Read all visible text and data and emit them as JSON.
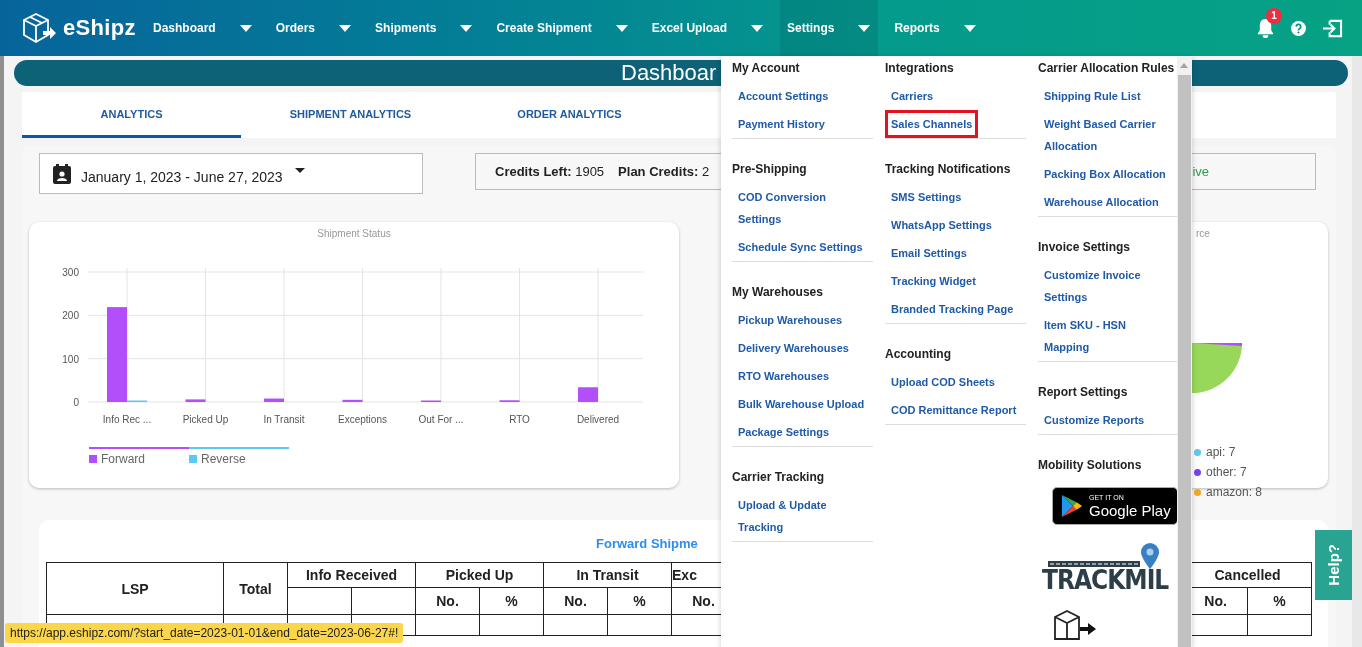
{
  "nav": {
    "brand": "eShipz",
    "items": [
      {
        "label": "Dashboard",
        "selected": false
      },
      {
        "label": "Orders",
        "selected": false
      },
      {
        "label": "Shipments",
        "selected": false
      },
      {
        "label": "Create Shipment",
        "selected": false
      },
      {
        "label": "Excel Upload",
        "selected": false
      },
      {
        "label": "Settings",
        "selected": true
      },
      {
        "label": "Reports",
        "selected": false
      }
    ],
    "notification_count": "1"
  },
  "page_title": "Dashboar",
  "tabs": [
    {
      "label": "ANALYTICS",
      "selected": true
    },
    {
      "label": "SHIPMENT ANALYTICS",
      "selected": false
    },
    {
      "label": "ORDER ANALYTICS",
      "selected": false
    }
  ],
  "filters": {
    "date_range": "January 1, 2023 - June 27, 2023",
    "credits": [
      {
        "label": "Credits Left:",
        "value": "1905"
      },
      {
        "label": "Plan Credits:",
        "value": "2"
      }
    ],
    "status_fragment": "ive"
  },
  "shipment_status_card": {
    "chart_data": {
      "type": "bar",
      "title": "Shipment Status",
      "categories": [
        "Info Rec ...",
        "Picked Up",
        "In Transit",
        "Exceptions",
        "Out For ...",
        "RTO",
        "Delivered"
      ],
      "series": [
        {
          "name": "Forward",
          "color": "#b24ffa",
          "values": [
            219,
            6,
            8,
            5,
            3,
            4,
            34
          ]
        },
        {
          "name": "Reverse",
          "color": "#5bc8f5",
          "values": [
            1,
            0,
            0,
            0,
            0,
            0,
            0
          ]
        }
      ],
      "ylim": [
        0,
        300
      ],
      "yticks": [
        0,
        100,
        200,
        300
      ],
      "grid": true,
      "legend": "bottom"
    }
  },
  "source_card": {
    "title_fragment": "rce",
    "legend": [
      {
        "label": "api: 7",
        "color": "#5bc8f5"
      },
      {
        "label": "other: 7",
        "color": "#7a3ff0"
      },
      {
        "label": "amazon: 8",
        "color": "#f5a623"
      }
    ]
  },
  "forward_table": {
    "title": "Forward Shipme",
    "columns": [
      "LSP",
      "Total"
    ],
    "groups": [
      {
        "label": "Info Received"
      },
      {
        "label": "Picked Up",
        "subheaders": [
          "No.",
          "%"
        ]
      },
      {
        "label": "In Transit",
        "subheaders": [
          "No.",
          "%"
        ]
      },
      {
        "label": "Exc",
        "subheaders": [
          "No."
        ]
      }
    ],
    "last_group": {
      "label": "Cancelled",
      "subheaders": [
        "No.",
        "%"
      ]
    }
  },
  "settings_menu": {
    "columns": [
      [
        {
          "kind": "links",
          "heading": "My Account",
          "items": [
            {
              "label": "Account Settings",
              "highlighted": false
            },
            {
              "label": "Payment History",
              "highlighted": false
            }
          ]
        },
        {
          "kind": "links",
          "heading": "Pre-Shipping",
          "items": [
            {
              "label": "COD Conversion Settings",
              "highlighted": false
            },
            {
              "label": "Schedule Sync Settings",
              "highlighted": false
            }
          ]
        },
        {
          "kind": "links",
          "heading": "My Warehouses",
          "items": [
            {
              "label": "Pickup Warehouses",
              "highlighted": false
            },
            {
              "label": "Delivery Warehouses",
              "highlighted": false
            },
            {
              "label": "RTO Warehouses",
              "highlighted": false
            },
            {
              "label": "Bulk Warehouse Upload",
              "highlighted": false
            },
            {
              "label": "Package Settings",
              "highlighted": false
            }
          ]
        },
        {
          "kind": "links",
          "heading": "Carrier Tracking",
          "items": [
            {
              "label": "Upload & Update Tracking",
              "highlighted": false
            }
          ]
        }
      ],
      [
        {
          "kind": "links",
          "heading": "Integrations",
          "items": [
            {
              "label": "Carriers",
              "highlighted": false
            },
            {
              "label": "Sales Channels",
              "highlighted": true
            }
          ]
        },
        {
          "kind": "links",
          "heading": "Tracking Notifications",
          "items": [
            {
              "label": "SMS Settings",
              "highlighted": false
            },
            {
              "label": "WhatsApp Settings",
              "highlighted": false
            },
            {
              "label": "Email Settings",
              "highlighted": false
            },
            {
              "label": "Tracking Widget",
              "highlighted": false
            },
            {
              "label": "Branded Tracking Page",
              "highlighted": false
            }
          ]
        },
        {
          "kind": "links",
          "heading": "Accounting",
          "items": [
            {
              "label": "Upload COD Sheets",
              "highlighted": false
            },
            {
              "label": "COD Remittance Report",
              "highlighted": false
            }
          ]
        }
      ],
      [
        {
          "kind": "links",
          "heading": "Carrier Allocation Rules",
          "items": [
            {
              "label": "Shipping Rule List",
              "highlighted": false
            },
            {
              "label": "Weight Based Carrier Allocation",
              "highlighted": false
            },
            {
              "label": "Packing Box Allocation",
              "highlighted": false
            },
            {
              "label": "Warehouse Allocation",
              "highlighted": false
            }
          ]
        },
        {
          "kind": "links",
          "heading": "Invoice Settings",
          "items": [
            {
              "label": "Customize Invoice Settings",
              "highlighted": false
            },
            {
              "label": "Item SKU - HSN Mapping",
              "highlighted": false
            }
          ]
        },
        {
          "kind": "links",
          "heading": "Report Settings",
          "items": [
            {
              "label": "Customize Reports",
              "highlighted": false
            }
          ]
        },
        {
          "kind": "apps",
          "heading": "Mobility Solutions",
          "badge_small": "GET IT ON",
          "badge_large": "Google Play",
          "logo_text": "TRACKMIL"
        }
      ]
    ]
  },
  "help_tab": "Help?",
  "status_url": "https://app.eshipz.com/?start_date=2023-01-01&end_date=2023-06-27#!"
}
